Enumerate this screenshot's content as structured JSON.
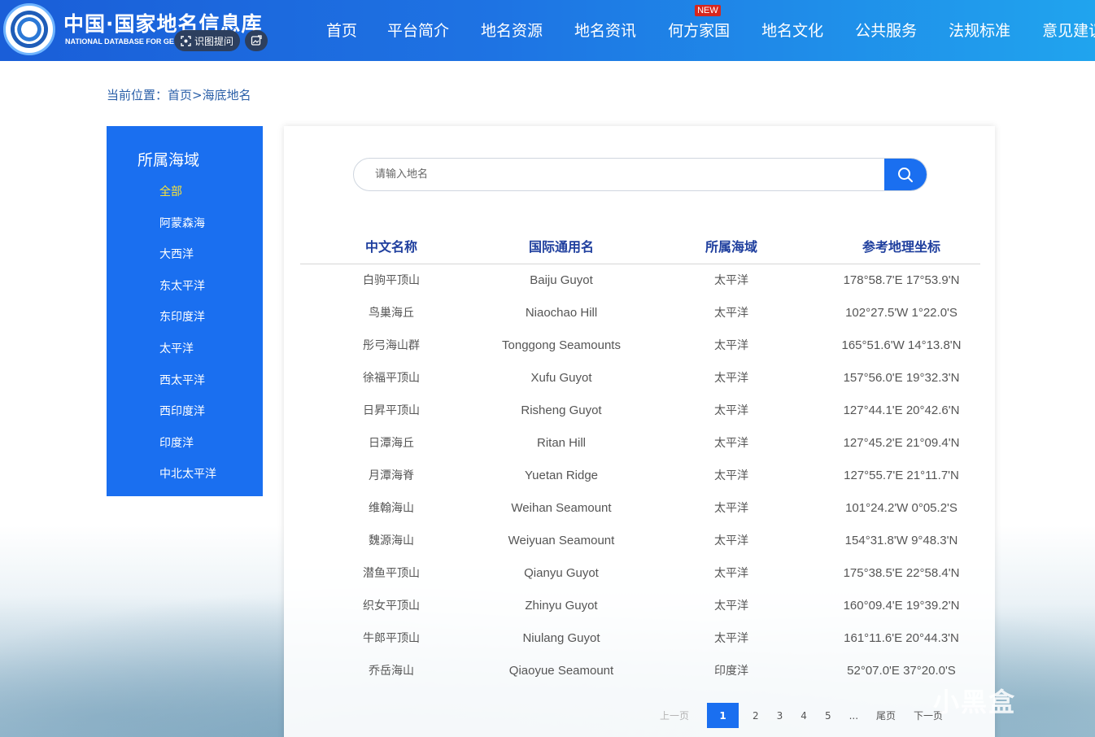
{
  "header": {
    "site_title": "中国·国家地名信息库",
    "site_subtitle": "NATIONAL DATABASE FOR GEOG",
    "tools": {
      "ocr_label": "识图提问"
    },
    "nav": [
      {
        "label": "首页"
      },
      {
        "label": "平台简介"
      },
      {
        "label": "地名资源"
      },
      {
        "label": "地名资讯"
      },
      {
        "label": "何方家国",
        "badge": "NEW"
      },
      {
        "label": "地名文化"
      },
      {
        "label": "公共服务"
      },
      {
        "label": "法规标准"
      },
      {
        "label": "意见建议"
      }
    ]
  },
  "breadcrumb": {
    "prefix": "当前位置：",
    "home": "首页",
    "sep": ">",
    "current": "海底地名"
  },
  "sidebar": {
    "title": "所属海域",
    "items": [
      {
        "label": "全部",
        "active": true
      },
      {
        "label": "阿蒙森海"
      },
      {
        "label": "大西洋"
      },
      {
        "label": "东太平洋"
      },
      {
        "label": "东印度洋"
      },
      {
        "label": "太平洋"
      },
      {
        "label": "西太平洋"
      },
      {
        "label": "西印度洋"
      },
      {
        "label": "印度洋"
      },
      {
        "label": "中北太平洋"
      }
    ]
  },
  "search": {
    "placeholder": "请输入地名"
  },
  "table": {
    "headers": [
      "中文名称",
      "国际通用名",
      "所属海域",
      "参考地理坐标"
    ],
    "rows": [
      [
        "白驹平顶山",
        "Baiju Guyot",
        "太平洋",
        "178°58.7'E 17°53.9'N"
      ],
      [
        "鸟巢海丘",
        "Niaochao Hill",
        "太平洋",
        "102°27.5'W 1°22.0'S"
      ],
      [
        "彤弓海山群",
        "Tonggong Seamounts",
        "太平洋",
        "165°51.6'W 14°13.8'N"
      ],
      [
        "徐福平顶山",
        "Xufu Guyot",
        "太平洋",
        "157°56.0'E 19°32.3'N"
      ],
      [
        "日昇平顶山",
        "Risheng Guyot",
        "太平洋",
        "127°44.1'E 20°42.6'N"
      ],
      [
        "日潭海丘",
        "Ritan Hill",
        "太平洋",
        "127°45.2'E 21°09.4'N"
      ],
      [
        "月潭海脊",
        "Yuetan Ridge",
        "太平洋",
        "127°55.7'E 21°11.7'N"
      ],
      [
        "维翰海山",
        "Weihan Seamount",
        "太平洋",
        "101°24.2'W 0°05.2'S"
      ],
      [
        "魏源海山",
        "Weiyuan Seamount",
        "太平洋",
        "154°31.8'W 9°48.3'N"
      ],
      [
        "潜鱼平顶山",
        "Qianyu Guyot",
        "太平洋",
        "175°38.5'E 22°58.4'N"
      ],
      [
        "织女平顶山",
        "Zhinyu Guyot",
        "太平洋",
        "160°09.4'E 19°39.2'N"
      ],
      [
        "牛郎平顶山",
        "Niulang Guyot",
        "太平洋",
        "161°11.6'E 20°44.3'N"
      ],
      [
        "乔岳海山",
        "Qiaoyue Seamount",
        "印度洋",
        "52°07.0'E 37°20.0'S"
      ]
    ]
  },
  "pager": {
    "prev": "上一页",
    "pages": [
      "1",
      "2",
      "3",
      "4",
      "5"
    ],
    "current": "1",
    "ellipsis": "...",
    "last": "尾页",
    "next": "下一页"
  },
  "watermark": "小黑盒",
  "colors": {
    "primary": "#1a6ff0",
    "header_start": "#1a5ed8",
    "header_end": "#20a4ee",
    "active_item": "#f6e23a",
    "table_header": "#1f3f9e",
    "new_badge": "#d8261c"
  }
}
